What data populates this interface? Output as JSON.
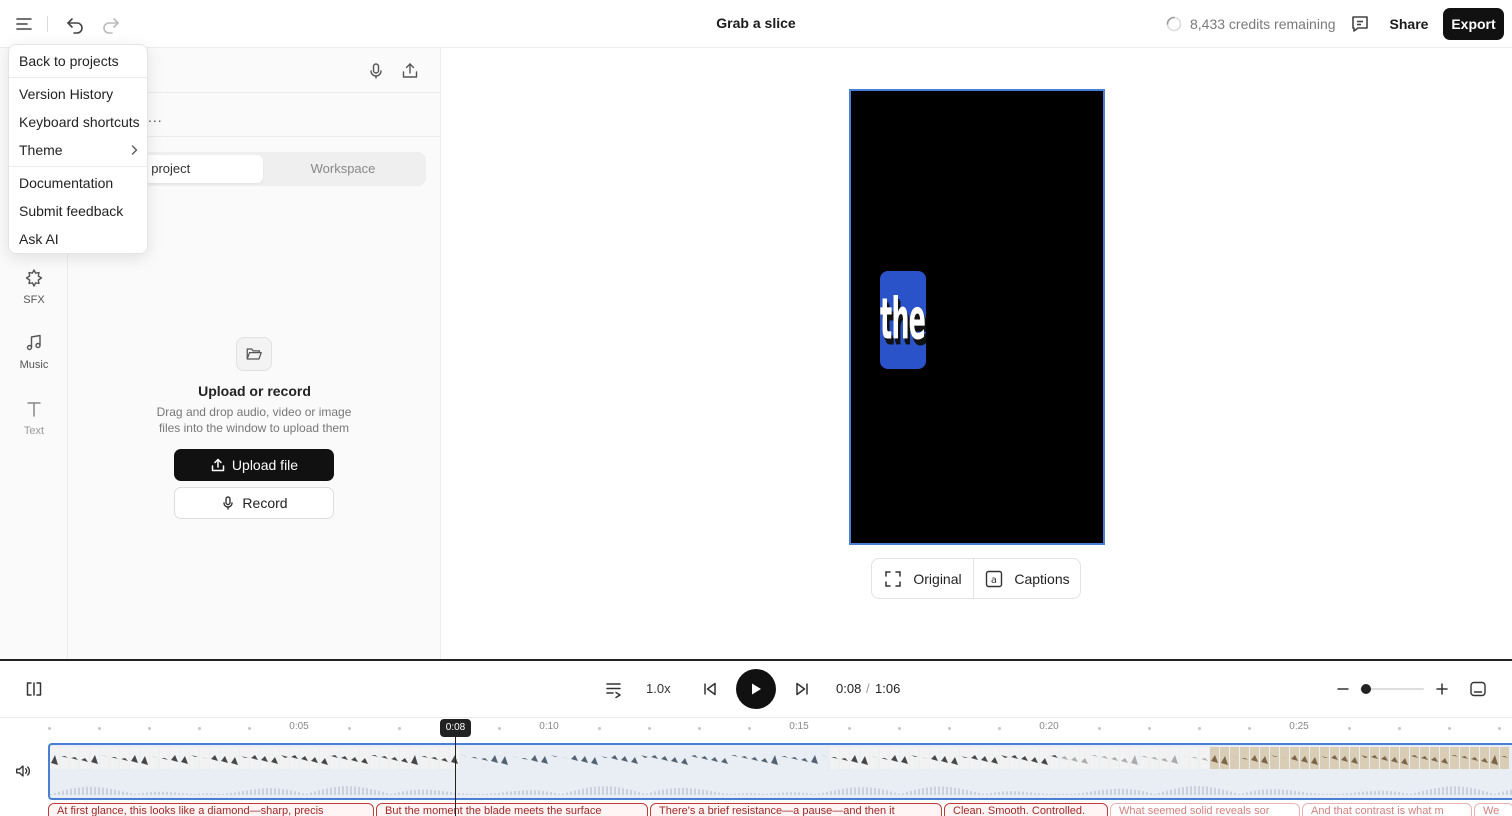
{
  "app": {
    "title": "Grab a slice",
    "credits": "8,433 credits remaining",
    "share_label": "Share",
    "export_label": "Export"
  },
  "menu": {
    "items": [
      "Back to projects",
      "Version History",
      "Keyboard shortcuts",
      "Theme",
      "Documentation",
      "Submit feedback",
      "Ask AI"
    ]
  },
  "rail": {
    "items": [
      {
        "label": "SFX",
        "icon": "sfx-icon"
      },
      {
        "label": "Music",
        "icon": "music-note-icon"
      },
      {
        "label": "Text",
        "icon": "text-icon"
      }
    ]
  },
  "media": {
    "ellipsis": "...",
    "tabs": [
      "his project",
      "Workspace"
    ],
    "empty_title": "Upload or record",
    "empty_desc": "Drag and drop audio, video or image files into the window to upload them",
    "upload_label": "Upload file",
    "record_label": "Record"
  },
  "preview": {
    "caption_word": "the",
    "view_original": "Original",
    "view_captions": "Captions",
    "canvas_color": "#000000",
    "caption_bg": "#2b53c9",
    "selection_color": "#4a7fd6"
  },
  "player": {
    "speed": "1.0x",
    "current_time": "0:08",
    "separator": "/",
    "total_time": "1:06",
    "zoom_level": 0.05
  },
  "timeline": {
    "ruler_labels": [
      "0:05",
      "0:10",
      "0:15",
      "0:20",
      "0:25"
    ],
    "playhead_label": "0:08",
    "captions": [
      "At first glance, this looks like a diamond—sharp, precis",
      "But the moment the blade meets the surface",
      "There's a brief resistance—a pause—and then it",
      "Clean. Smooth. Controlled.",
      "What seemed solid reveals sor",
      "And that contrast is what m",
      "We"
    ]
  }
}
